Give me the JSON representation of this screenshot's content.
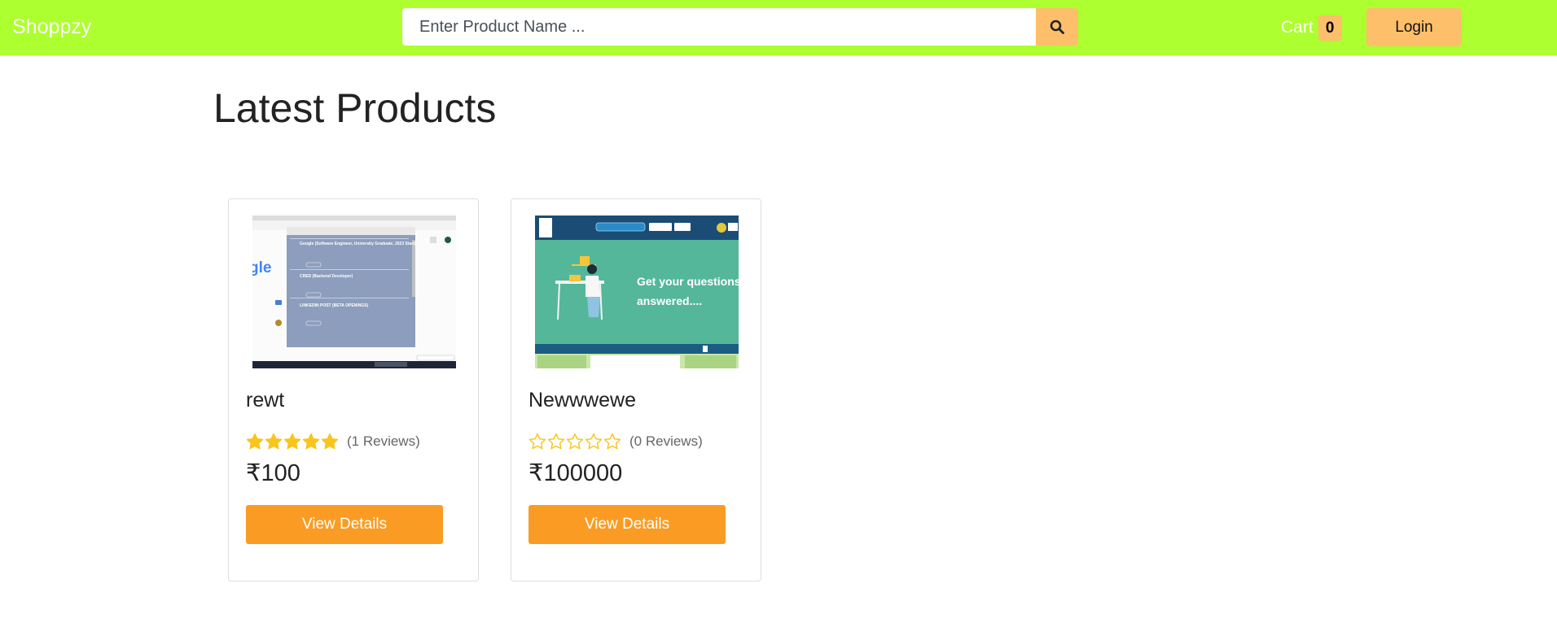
{
  "navbar": {
    "brand": "Shoppzy",
    "search": {
      "placeholder": "Enter Product Name ...",
      "value": "",
      "button_icon": "search-icon"
    },
    "cart": {
      "label": "Cart",
      "count": "0"
    },
    "login_label": "Login"
  },
  "main": {
    "title": "Latest Products",
    "products": [
      {
        "name": "rewt",
        "rating": 5,
        "reviews": "(1 Reviews)",
        "price": "₹100",
        "button_label": "View Details",
        "thumbnail": {
          "logo_fragment": "gle",
          "entries": [
            "Google (Software Engineer, University Graduate, 2023 Start)",
            "CRED (Backend Developer)",
            "LINKEDIN POST (BETA OPENINGS)"
          ]
        }
      },
      {
        "name": "Newwwewe",
        "rating": 0,
        "reviews": "(0 Reviews)",
        "price": "₹100000",
        "button_label": "View Details",
        "thumbnail": {
          "headline_line1": "Get your questions",
          "headline_line2": "answered...."
        }
      }
    ]
  },
  "colors": {
    "navbar_bg": "#adff2f",
    "accent": "#febf6b",
    "button": "#fa9c23",
    "star": "#f8c51c"
  }
}
